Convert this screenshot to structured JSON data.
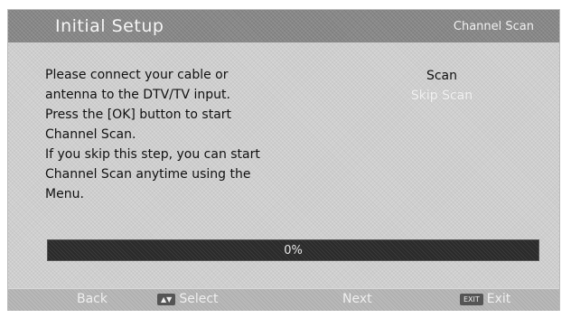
{
  "header": {
    "title": "Initial Setup",
    "section": "Channel Scan"
  },
  "instructions": [
    "Please connect your cable or",
    "antenna to the DTV/TV input.",
    "Press the [OK] button to start",
    "Channel Scan.",
    "If you skip this step, you can start",
    "Channel Scan anytime using the",
    "Menu."
  ],
  "options": {
    "scan": "Scan",
    "skip_scan": "Skip Scan",
    "selected": "Scan"
  },
  "progress": {
    "value": 0,
    "label": "0%"
  },
  "footer": {
    "back": "Back",
    "select_key": "▲▼",
    "select": "Select",
    "next": "Next",
    "exit_key": "EXIT",
    "exit": "Exit"
  },
  "colors": {
    "header_bg": "#8a8a8a",
    "panel_bg": "#cfcfcf",
    "progress_bg": "#2a2a2a"
  }
}
